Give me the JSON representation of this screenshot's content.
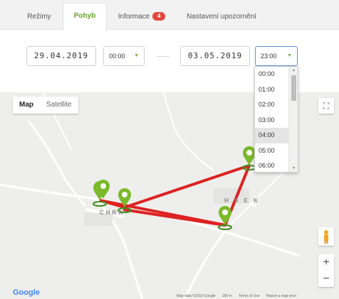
{
  "tabs": [
    {
      "label": "Režimy"
    },
    {
      "label": "Pohyb",
      "active": true
    },
    {
      "label": "Informace",
      "badge": "4"
    },
    {
      "label": "Nastavení upozornění"
    }
  ],
  "filter": {
    "date_from": "29.04.2019",
    "time_from": "00:00",
    "date_to": "03.05.2019",
    "time_to": "23:00"
  },
  "time_options": [
    "00:00",
    "01:00",
    "02:00",
    "03:00",
    "04:00",
    "05:00",
    "06:00"
  ],
  "hovered_option": "04:00",
  "map": {
    "type_buttons": [
      "Map",
      "Satellite"
    ],
    "active_type": "Map",
    "google_logo": "Google",
    "place_labels": [
      "CHRA",
      "H  S E K"
    ],
    "attribution": [
      "Map data ©2019 Google",
      "200 m",
      "Terms of Use",
      "Report a map error"
    ],
    "zoom_in": "+",
    "zoom_out": "−"
  },
  "colors": {
    "accent_green": "#6aa12d",
    "route_red": "#dd2222",
    "marker_green": "#7ab929",
    "badge_red": "#e1473c"
  },
  "icons": [
    "fullscreen-icon",
    "pegman-icon",
    "dropdown-caret-icon",
    "map-marker-icon"
  ]
}
